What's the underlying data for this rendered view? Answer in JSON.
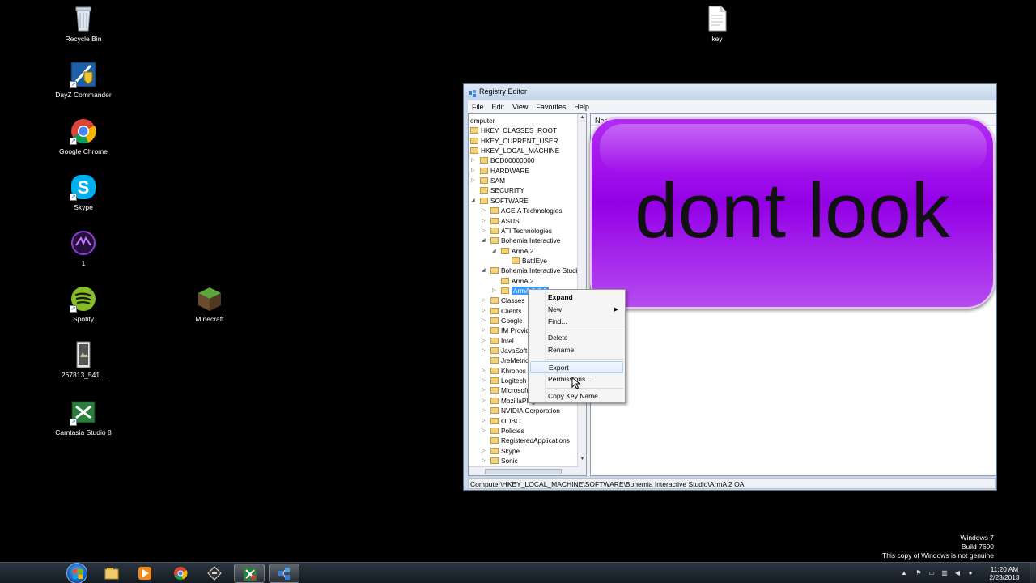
{
  "desktop": {
    "icons": [
      {
        "label": "Recycle Bin",
        "icon": "recycle-bin-icon"
      },
      {
        "label": "DayZ Commander",
        "icon": "dayz-commander-icon"
      },
      {
        "label": "Google Chrome",
        "icon": "chrome-icon"
      },
      {
        "label": "Skype",
        "icon": "skype-icon"
      },
      {
        "label": "1",
        "icon": "app-1-icon"
      },
      {
        "label": "Spotify",
        "icon": "spotify-icon"
      },
      {
        "label": "267813_541...",
        "icon": "image-file-icon"
      },
      {
        "label": "Camtasia Studio 8",
        "icon": "camtasia-icon"
      },
      {
        "label": "Minecraft",
        "icon": "minecraft-icon"
      },
      {
        "label": "key",
        "icon": "text-file-icon"
      }
    ]
  },
  "regedit": {
    "title": "Registry Editor",
    "menu": [
      "File",
      "Edit",
      "View",
      "Favorites",
      "Help"
    ],
    "list_header": "Name",
    "status_path": "Computer\\HKEY_LOCAL_MACHINE\\SOFTWARE\\Bohemia Interactive Studio\\ArmA 2 OA",
    "tree": [
      {
        "label": "omputer",
        "indent": 0,
        "arrow": ""
      },
      {
        "label": "HKEY_CLASSES_ROOT",
        "indent": 0,
        "arrow": ""
      },
      {
        "label": "HKEY_CURRENT_USER",
        "indent": 0,
        "arrow": ""
      },
      {
        "label": "HKEY_LOCAL_MACHINE",
        "indent": 0,
        "arrow": ""
      },
      {
        "label": "BCD00000000",
        "indent": 1,
        "arrow": "▷"
      },
      {
        "label": "HARDWARE",
        "indent": 1,
        "arrow": "▷"
      },
      {
        "label": "SAM",
        "indent": 1,
        "arrow": "▷"
      },
      {
        "label": "SECURITY",
        "indent": 1,
        "arrow": ""
      },
      {
        "label": "SOFTWARE",
        "indent": 1,
        "arrow": "◢"
      },
      {
        "label": "AGEIA Technologies",
        "indent": 2,
        "arrow": "▷"
      },
      {
        "label": "ASUS",
        "indent": 2,
        "arrow": "▷"
      },
      {
        "label": "ATI Technologies",
        "indent": 2,
        "arrow": "▷"
      },
      {
        "label": "Bohemia Interactive",
        "indent": 2,
        "arrow": "◢"
      },
      {
        "label": "ArmA 2",
        "indent": 3,
        "arrow": "◢"
      },
      {
        "label": "BattlEye",
        "indent": 4,
        "arrow": ""
      },
      {
        "label": "Bohemia Interactive Studio",
        "indent": 2,
        "arrow": "◢"
      },
      {
        "label": "ArmA 2",
        "indent": 3,
        "arrow": ""
      },
      {
        "label": "ArmA 2 OA",
        "indent": 3,
        "arrow": "▷",
        "selected": true
      },
      {
        "label": "Classes",
        "indent": 2,
        "arrow": "▷"
      },
      {
        "label": "Clients",
        "indent": 2,
        "arrow": "▷"
      },
      {
        "label": "Google",
        "indent": 2,
        "arrow": "▷"
      },
      {
        "label": "IM Provide",
        "indent": 2,
        "arrow": "▷"
      },
      {
        "label": "Intel",
        "indent": 2,
        "arrow": "▷"
      },
      {
        "label": "JavaSoft",
        "indent": 2,
        "arrow": "▷"
      },
      {
        "label": "JreMetrics",
        "indent": 2,
        "arrow": ""
      },
      {
        "label": "Khronos",
        "indent": 2,
        "arrow": "▷"
      },
      {
        "label": "Logitech",
        "indent": 2,
        "arrow": "▷"
      },
      {
        "label": "Microsoft",
        "indent": 2,
        "arrow": "▷"
      },
      {
        "label": "MozillaPlug",
        "indent": 2,
        "arrow": "▷"
      },
      {
        "label": "NVIDIA Corporation",
        "indent": 2,
        "arrow": "▷"
      },
      {
        "label": "ODBC",
        "indent": 2,
        "arrow": "▷"
      },
      {
        "label": "Policies",
        "indent": 2,
        "arrow": "▷"
      },
      {
        "label": "RegisteredApplications",
        "indent": 2,
        "arrow": ""
      },
      {
        "label": "Skype",
        "indent": 2,
        "arrow": "▷"
      },
      {
        "label": "Sonic",
        "indent": 2,
        "arrow": "▷"
      }
    ]
  },
  "overlay": {
    "text": "dont look",
    "color": "#9b00e8"
  },
  "context_menu": {
    "items": [
      {
        "label": "Expand",
        "bold": true
      },
      {
        "label": "New",
        "submenu": true
      },
      {
        "label": "Find..."
      },
      {
        "separator": true
      },
      {
        "label": "Delete"
      },
      {
        "label": "Rename"
      },
      {
        "separator": true
      },
      {
        "label": "Export",
        "hover": true
      },
      {
        "label": "Permissions..."
      },
      {
        "separator": true
      },
      {
        "label": "Copy Key Name"
      }
    ]
  },
  "watermark": {
    "line1": "Windows 7",
    "line2": "Build 7600",
    "line3": "This copy of Windows is not genuine"
  },
  "taskbar": {
    "buttons": [
      "explorer-icon",
      "media-player-icon",
      "chrome-icon",
      "app-icon",
      "dayz-commander-icon",
      "regedit-icon"
    ],
    "time": "11:20 AM",
    "date": "2/23/2013"
  }
}
